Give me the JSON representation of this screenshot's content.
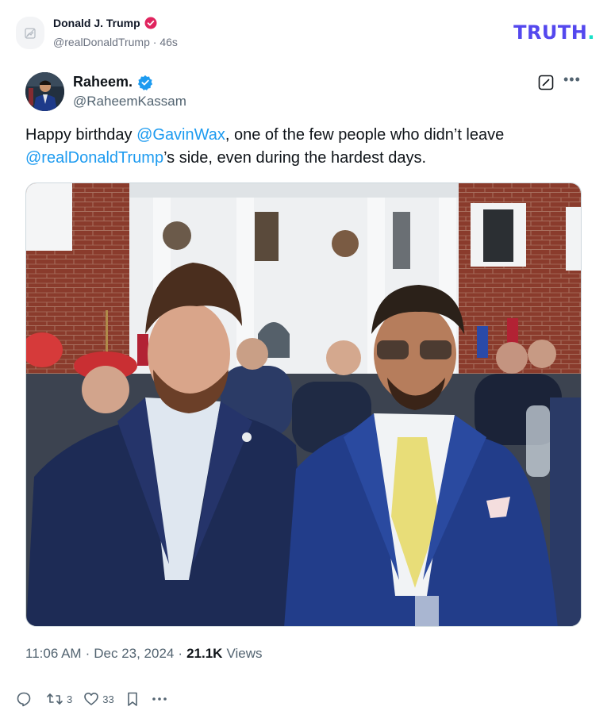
{
  "header": {
    "author_name": "Donald J. Trump",
    "author_handle": "@realDonaldTrump",
    "separator": "·",
    "time_ago": "46s",
    "logo_text": "TRUTH",
    "logo_dot": ".",
    "verified_badge_color": "#e0245e",
    "brand_color": "#5448ee",
    "brand_accent": "#18e0c8"
  },
  "post": {
    "author_name": "Raheem.",
    "author_handle": "@RaheemKassam",
    "verified_badge_color": "#1d9bf0",
    "text_parts": {
      "p1": "Happy birthday ",
      "m1": "@GavinWax",
      "p2": ", one of the few people who didn’t leave ",
      "m2": "@realDonaldTrump",
      "p3": "’s side, even during the hardest days."
    },
    "mention_color": "#1d9bf0",
    "time": "11:06 AM",
    "dot": "·",
    "date": "Dec 23, 2024",
    "views_count": "21.1K",
    "views_label": "Views",
    "actions": {
      "reply_count": "",
      "repost_count": "3",
      "like_count": "33"
    }
  }
}
